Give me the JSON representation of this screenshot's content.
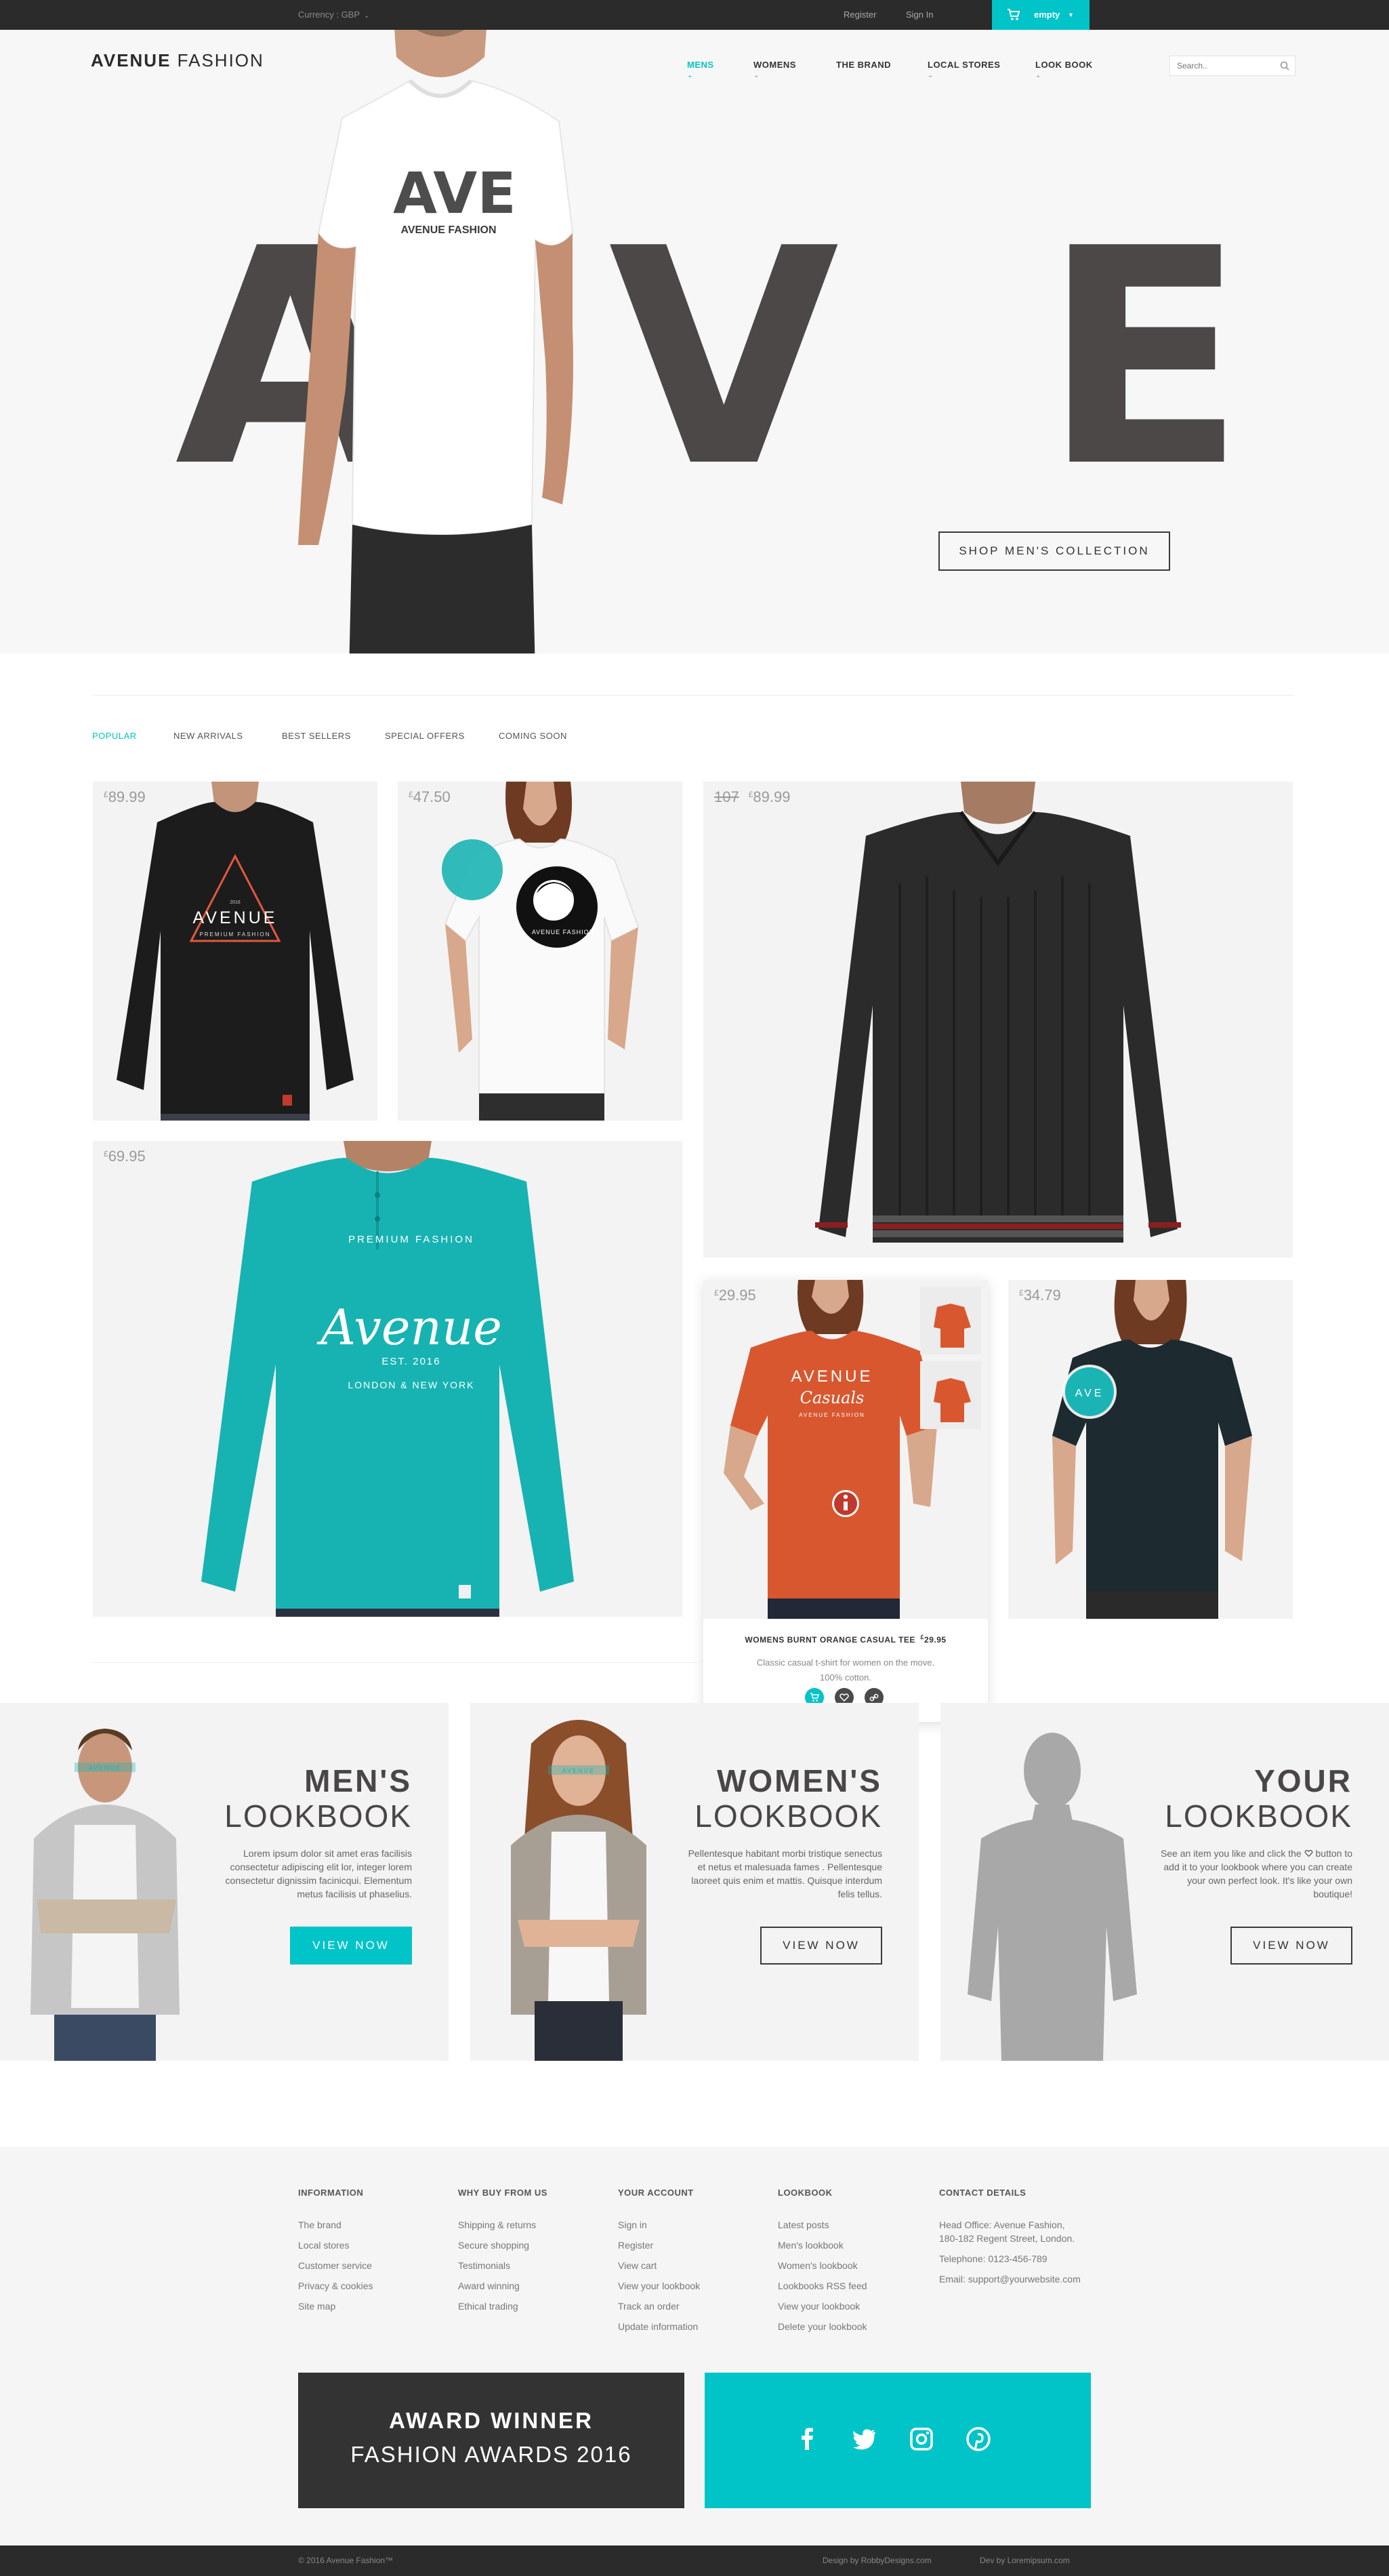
{
  "topbar": {
    "currency_label": "Currency : GBP",
    "register": "Register",
    "sign_in": "Sign In",
    "cart_label": "empty"
  },
  "header": {
    "logo_bold": "AVENUE",
    "logo_light": " FASHION",
    "nav": [
      "MENS",
      "WOMENS",
      "THE BRAND",
      "LOCAL STORES",
      "LOOK BOOK"
    ],
    "active_nav": "MENS",
    "search_placeholder": "Search.."
  },
  "hero": {
    "letters": [
      "A",
      "V",
      "E"
    ],
    "shirt_text": "AVENUE FASHION",
    "shirt_letters": "AVE",
    "cta": "SHOP MEN'S COLLECTION"
  },
  "product_tabs": [
    "POPULAR",
    "NEW ARRIVALS",
    "BEST SELLERS",
    "SPECIAL OFFERS",
    "COMING SOON"
  ],
  "products": [
    {
      "price_currency": "£",
      "price": "89.99"
    },
    {
      "price_currency": "£",
      "price": "47.50"
    },
    {
      "old_price": "107",
      "price_currency": "£",
      "price": "89.99"
    },
    {
      "price_currency": "£",
      "price": "69.95"
    },
    {
      "price_currency": "£",
      "price": "29.95"
    },
    {
      "price_currency": "£",
      "price": "34.79"
    }
  ],
  "graphics": {
    "tee1_line1": "AVENUE",
    "tee1_line2": "PREMIUM FASHION",
    "tee1_year": "2016",
    "tee2_text": "AVENUE FASHION",
    "teal_arc": "PREMIUM FASHION",
    "teal_script": "Avenue",
    "teal_est": "EST. 2016",
    "teal_city": "LONDON & NEW YORK",
    "orange_line1": "AVENUE",
    "orange_script": "Casuals",
    "orange_line3": "AVENUE FASHION",
    "dark_badge": "AVE"
  },
  "popup": {
    "title": "WOMENS BURNT ORANGE CASUAL TEE",
    "price_currency": "£",
    "price": "29.95",
    "desc_line1": "Classic casual t-shirt for women on the move.",
    "desc_line2": "100% cotton."
  },
  "lookbooks": [
    {
      "line1": "MEN'S",
      "line2": "LOOKBOOK",
      "text": "Lorem ipsum dolor sit amet eras facilisis consectetur adipiscing elit lor, integer lorem consectetur dignissim facinicqui. Elementum metus facilisis ut phaselius.",
      "button": "VIEW NOW",
      "figure_tag": "AVENUE"
    },
    {
      "line1": "WOMEN'S",
      "line2": "LOOKBOOK",
      "text": "Pellentesque habitant morbi tristique senectus et netus et malesuada fames . Pellentesque laoreet quis enim et mattis. Quisque interdum felis tellus.",
      "button": "VIEW NOW",
      "figure_tag": "AVENUE"
    },
    {
      "line1": "YOUR",
      "line2": "LOOKBOOK",
      "text_a": "See an item you like and click the",
      "text_b": "button to add it to your lookbook where you can create your own perfect look. It's like your own boutique!",
      "button": "VIEW NOW"
    }
  ],
  "footer": {
    "columns": [
      {
        "heading": "INFORMATION",
        "links": [
          "The brand",
          "Local stores",
          "Customer service",
          "Privacy & cookies",
          "Site map"
        ]
      },
      {
        "heading": "WHY BUY FROM US",
        "links": [
          "Shipping & returns",
          "Secure shopping",
          "Testimonials",
          "Award winning",
          "Ethical trading"
        ]
      },
      {
        "heading": "YOUR ACCOUNT",
        "links": [
          "Sign in",
          "Register",
          "View cart",
          "View your lookbook",
          "Track an order",
          "Update information"
        ]
      },
      {
        "heading": "LOOKBOOK",
        "links": [
          "Latest posts",
          "Men's lookbook",
          "Women's lookbook",
          "Lookbooks RSS feed",
          "View your lookbook",
          "Delete your lookbook"
        ]
      }
    ],
    "contact": {
      "heading": "CONTACT DETAILS",
      "address_line1": "Head Office: Avenue Fashion,",
      "address_line2": "180-182 Regent Street, London.",
      "telephone": "Telephone: 0123-456-789",
      "email": "Email: support@yourwebsite.com"
    },
    "award_line1": "AWARD WINNER",
    "award_line2": "FASHION AWARDS 2016",
    "social_icons": [
      "facebook-icon",
      "twitter-icon",
      "instagram-icon",
      "pinterest-icon"
    ],
    "copyright": "© 2016 Avenue Fashion™",
    "design_credit": "Design by RobbyDesigns.com",
    "dev_credit": "Dev by Loremipsum.com"
  },
  "colors": {
    "accent": "#00c4c8",
    "dark": "#2b2b2b",
    "hero_letters": "#4c4848",
    "orange_tee": "#d9572f",
    "teal_tee": "#1bb4b4"
  }
}
